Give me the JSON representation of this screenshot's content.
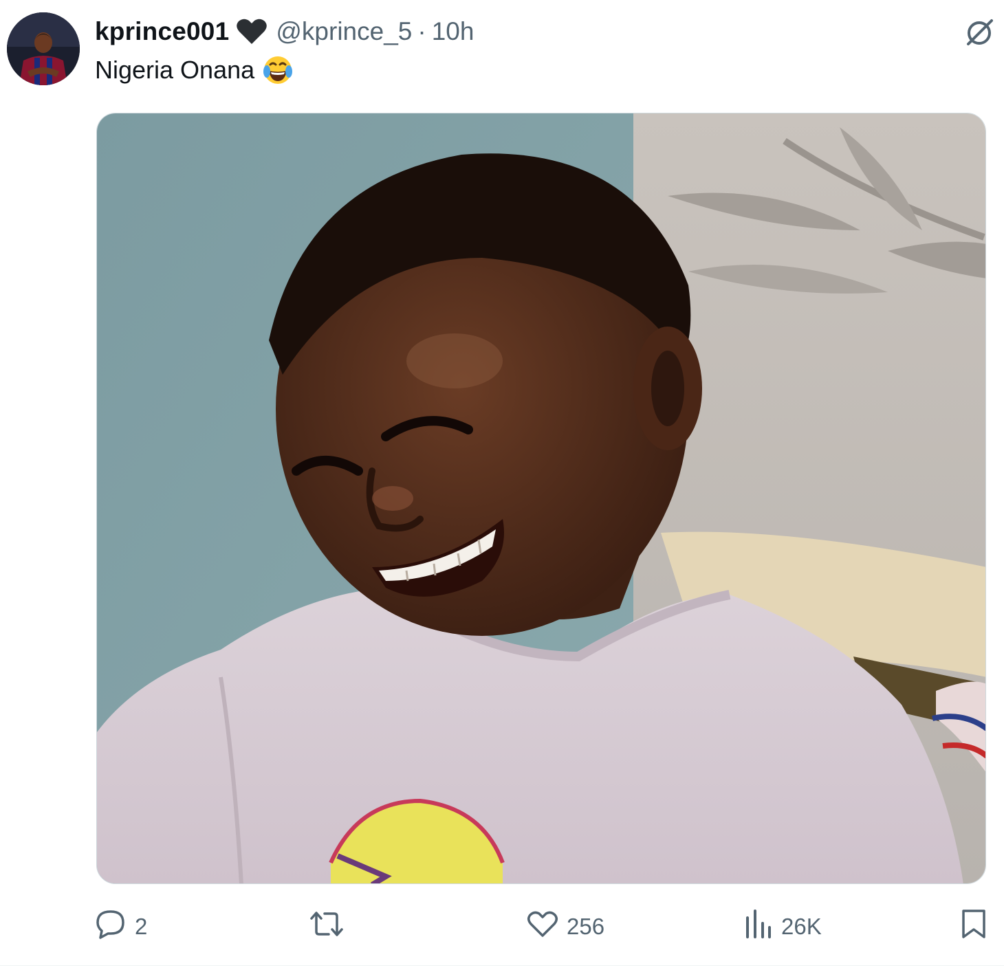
{
  "author": {
    "display_name": "kprince001",
    "badge_icon": "black-heart-icon",
    "handle": "@kprince_5",
    "separator": "·",
    "time": "10h",
    "avatar_icon": "profile-photo"
  },
  "tweet": {
    "text": "Nigeria Onana",
    "emoji_icon": "face-with-tears-of-joy-icon"
  },
  "media": {
    "image_icon": "meme-photo-smiling-boy"
  },
  "actions": {
    "reply_count": "2",
    "retweet_count": "",
    "like_count": "256",
    "view_count": "26K"
  },
  "colors": {
    "text_primary": "#0f1419",
    "text_secondary": "#536471",
    "border": "#cfd9de"
  }
}
